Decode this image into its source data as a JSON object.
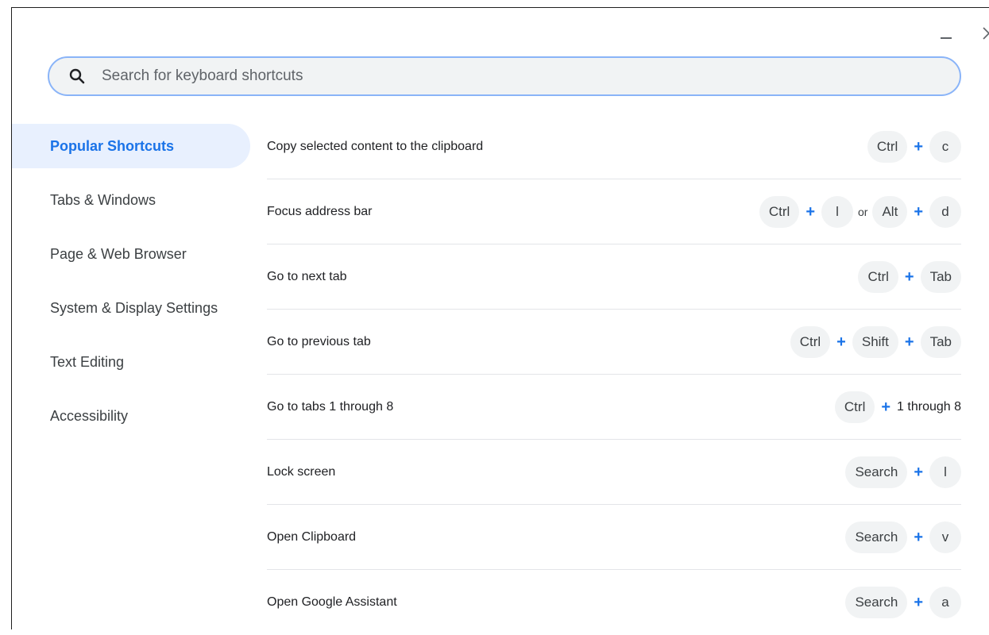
{
  "search": {
    "placeholder": "Search for keyboard shortcuts"
  },
  "sidebar": {
    "items": [
      {
        "label": "Popular Shortcuts",
        "active": true
      },
      {
        "label": "Tabs & Windows",
        "active": false
      },
      {
        "label": "Page & Web Browser",
        "active": false
      },
      {
        "label": "System & Display Settings",
        "active": false
      },
      {
        "label": "Text Editing",
        "active": false
      },
      {
        "label": "Accessibility",
        "active": false
      }
    ]
  },
  "shortcuts": [
    {
      "description": "Copy selected content to the clipboard",
      "keys": [
        "Ctrl",
        "c"
      ]
    },
    {
      "description": "Focus address bar",
      "keys": [
        "Ctrl",
        "l"
      ],
      "separator": "or",
      "alt_keys": [
        "Alt",
        "d"
      ]
    },
    {
      "description": "Go to next tab",
      "keys": [
        "Ctrl",
        "Tab"
      ]
    },
    {
      "description": "Go to previous tab",
      "keys": [
        "Ctrl",
        "Shift",
        "Tab"
      ]
    },
    {
      "description": "Go to tabs 1 through 8",
      "keys": [
        "Ctrl"
      ],
      "trailing_text": "1 through 8"
    },
    {
      "description": "Lock screen",
      "keys": [
        "Search",
        "l"
      ]
    },
    {
      "description": "Open Clipboard",
      "keys": [
        "Search",
        "v"
      ]
    },
    {
      "description": "Open Google Assistant",
      "keys": [
        "Search",
        "a"
      ]
    }
  ],
  "colors": {
    "accent": "#1a73e8",
    "active_bg": "#e8f0fe",
    "key_bg": "#f1f3f4",
    "search_border": "#8ab4f8"
  },
  "icons": {
    "search": "search-icon",
    "minimize": "minimize-icon",
    "close": "close-icon"
  }
}
